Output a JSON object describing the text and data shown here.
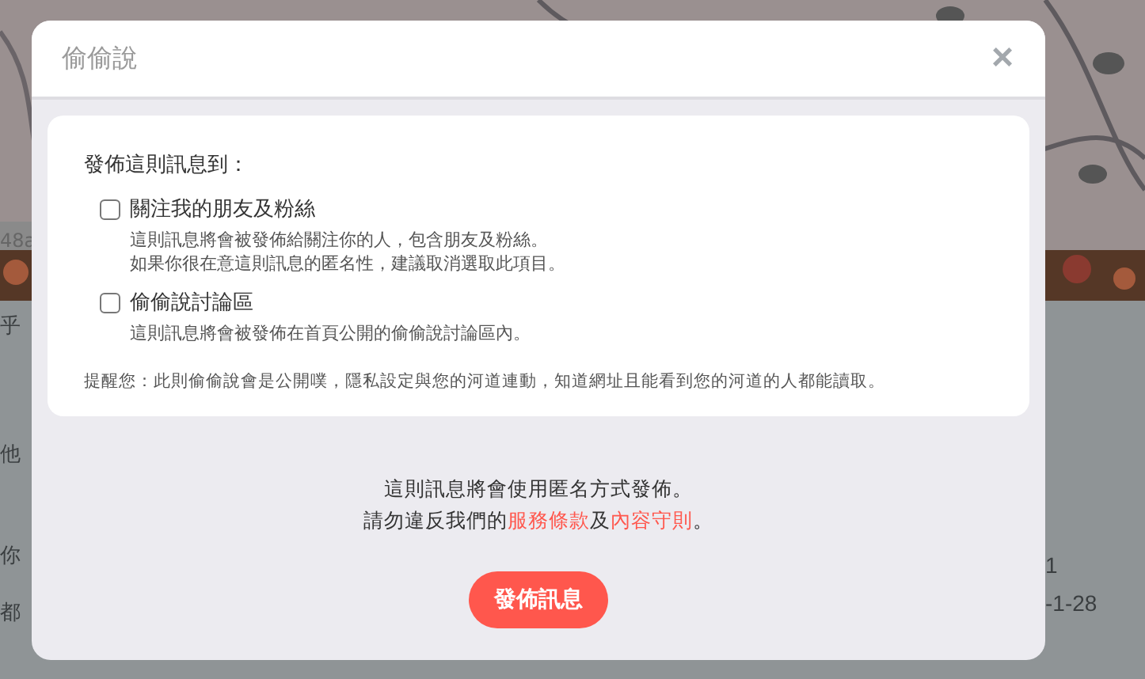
{
  "background": {
    "fragments": [
      {
        "text": "48a",
        "kind": "meta"
      },
      {
        "text": "乎",
        "kind": "body"
      },
      {
        "text": "他",
        "kind": "body"
      },
      {
        "text": "你",
        "kind": "body"
      },
      {
        "text": "都",
        "kind": "body"
      },
      {
        "text": "1",
        "kind": "date"
      },
      {
        "text": "-1-28",
        "kind": "date"
      }
    ]
  },
  "dialog": {
    "title": "偷偷說",
    "close": "×",
    "section_label": "發佈這則訊息到：",
    "options": [
      {
        "label": "關注我的朋友及粉絲",
        "checked": false,
        "description": [
          "這則訊息將會被發佈給關注你的人，包含朋友及粉絲。",
          "如果你很在意這則訊息的匿名性，建議取消選取此項目。"
        ]
      },
      {
        "label": "偷偷說討論區",
        "checked": false,
        "description": [
          "這則訊息將會被發佈在首頁公開的偷偷說討論區內。"
        ]
      }
    ],
    "reminder": "提醒您：此則偷偷說會是公開噗，隱私設定與您的河道連動，知道網址且能看到您的河道的人都能讀取。",
    "notice": "這則訊息將會使用匿名方式發佈。",
    "rules": {
      "before": "請勿違反我們的",
      "link1": "服務條款",
      "between": "及",
      "link2": "內容守則",
      "after": "。"
    },
    "submit": "發佈訊息"
  }
}
